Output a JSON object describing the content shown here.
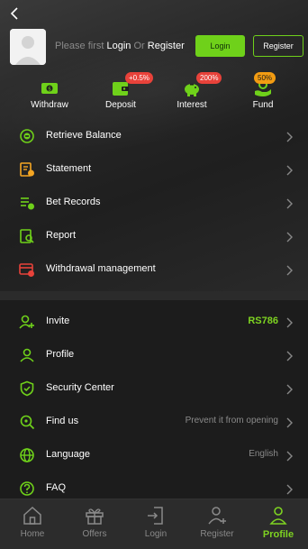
{
  "colors": {
    "accent": "#6fd11a",
    "badge_red": "#e8423a",
    "badge_orange": "#f39c12"
  },
  "header": {
    "login_prompt_prefix": "Please first",
    "login_link": "Login",
    "or_text": "Or",
    "register_link": "Register",
    "login_button": "Login",
    "register_button": "Register"
  },
  "quick_actions": [
    {
      "label": "Withdraw",
      "icon": "withdraw-icon",
      "badge": ""
    },
    {
      "label": "Deposit",
      "icon": "deposit-wallet-icon",
      "badge": "+0.5%"
    },
    {
      "label": "Interest",
      "icon": "piggy-bank-icon",
      "badge": "200%"
    },
    {
      "label": "Fund",
      "icon": "fund-hand-icon",
      "badge": "50%"
    }
  ],
  "menu_top": [
    {
      "label": "Retrieve Balance",
      "icon": "retrieve-balance-icon"
    },
    {
      "label": "Statement",
      "icon": "statement-icon"
    },
    {
      "label": "Bet Records",
      "icon": "bet-records-icon"
    },
    {
      "label": "Report",
      "icon": "report-icon"
    },
    {
      "label": "Withdrawal management",
      "icon": "withdrawal-management-icon"
    }
  ],
  "menu_bottom": [
    {
      "label": "Invite",
      "value": "RS786",
      "icon": "invite-icon"
    },
    {
      "label": "Profile",
      "value": "",
      "icon": "profile-icon"
    },
    {
      "label": "Security Center",
      "value": "",
      "icon": "shield-icon"
    },
    {
      "label": "Find us",
      "value": "Prevent it from opening",
      "icon": "find-us-icon"
    },
    {
      "label": "Language",
      "value": "English",
      "icon": "globe-icon"
    },
    {
      "label": "FAQ",
      "value": "",
      "icon": "faq-icon"
    }
  ],
  "tabbar": [
    {
      "label": "Home",
      "icon": "home-icon",
      "active": false
    },
    {
      "label": "Offers",
      "icon": "gift-icon",
      "active": false
    },
    {
      "label": "Login",
      "icon": "login-icon",
      "active": false
    },
    {
      "label": "Register",
      "icon": "register-user-icon",
      "active": false
    },
    {
      "label": "Profile",
      "icon": "profile-user-icon",
      "active": true
    }
  ]
}
